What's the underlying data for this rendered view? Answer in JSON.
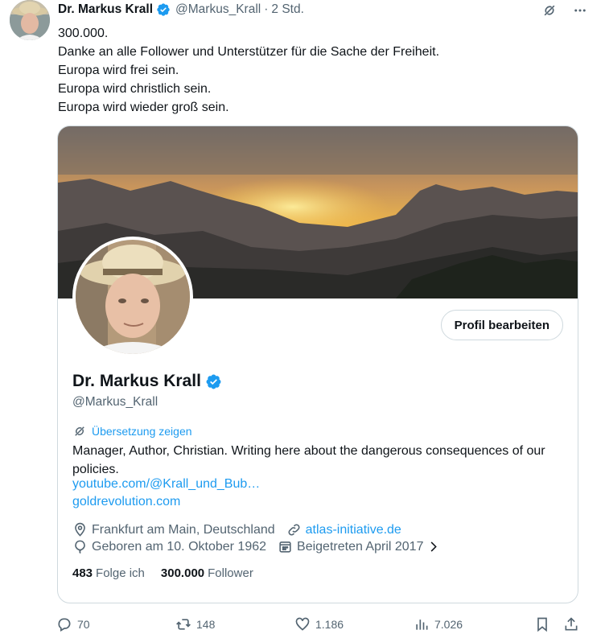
{
  "tweet": {
    "author_name": "Dr. Markus Krall",
    "author_handle": "@Markus_Krall",
    "separator": "·",
    "time": "2 Std.",
    "lines": [
      "300.000.",
      "Danke an alle Follower und Unterstützer für die Sache der Freiheit.",
      "Europa wird frei sein.",
      "Europa wird christlich sein.",
      "Europa wird wieder groß sein."
    ]
  },
  "profile_card": {
    "edit_button": "Profil bearbeiten",
    "name": "Dr. Markus Krall",
    "handle": "@Markus_Krall",
    "translate": "Übersetzung zeigen",
    "bio": "Manager, Author, Christian. Writing here about the dangerous consequences of our policies.",
    "links": [
      "youtube.com/@Krall_und_Bub…",
      "goldrevolution.com"
    ],
    "location": "Frankfurt am Main, Deutschland",
    "website": "atlas-initiative.de",
    "born": "Geboren am 10. Oktober 1962",
    "joined": "Beigetreten April 2017",
    "following_count": "483",
    "following_label": "Folge ich",
    "followers_count": "300.000",
    "followers_label": "Follower"
  },
  "actions": {
    "replies": "70",
    "retweets": "148",
    "likes": "1.186",
    "views": "7.026"
  },
  "colors": {
    "accent": "#1d9bf0",
    "muted": "#536471",
    "text": "#0f1419",
    "border": "#cfd9de"
  },
  "icons": {
    "verified": "verified-badge-icon",
    "grok": "grok-icon",
    "more": "more-icon",
    "translate": "translate-icon",
    "location": "location-icon",
    "link": "link-icon",
    "birthday": "balloon-icon",
    "calendar": "calendar-icon",
    "chevron": "chevron-right-icon",
    "reply": "reply-icon",
    "retweet": "retweet-icon",
    "like": "heart-icon",
    "views": "views-icon",
    "bookmark": "bookmark-icon",
    "share": "share-icon"
  }
}
